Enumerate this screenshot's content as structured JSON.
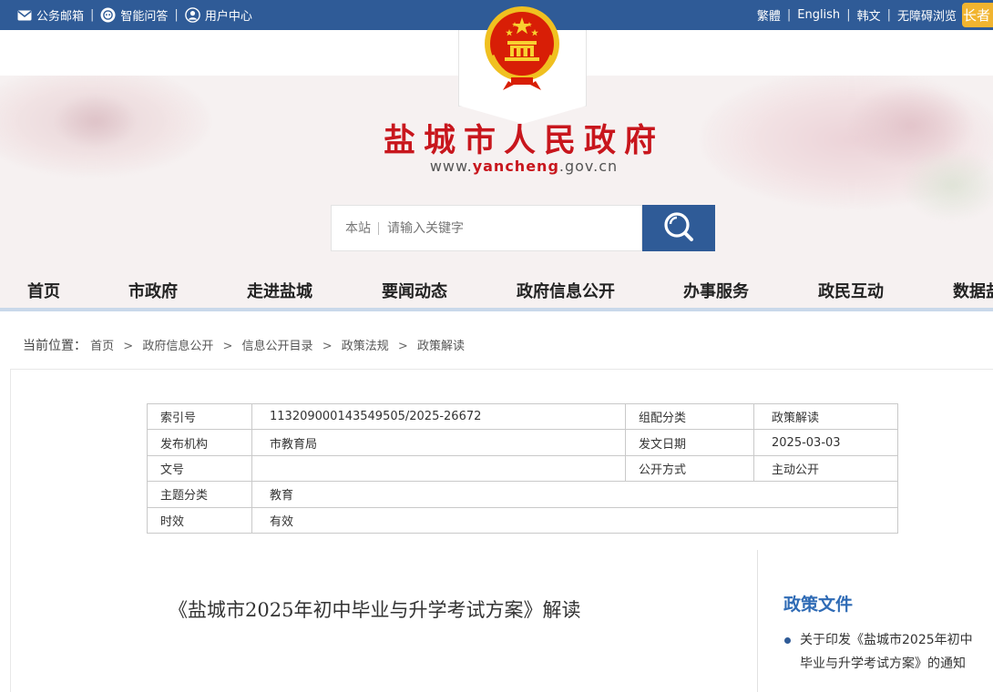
{
  "topbar": {
    "mail": "公务邮箱",
    "qa": "智能问答",
    "user": "用户中心",
    "lang_traditional": "繁體",
    "lang_english": "English",
    "lang_korean": "韩文",
    "accessibility": "无障碍浏览",
    "elder_mode": "长者"
  },
  "header": {
    "site_name": "盐城市人民政府",
    "url_prefix": "www.",
    "url_highlight": "yancheng",
    "url_suffix": ".gov.cn"
  },
  "search": {
    "scope": "本站",
    "placeholder": "请输入关键字"
  },
  "nav": {
    "items": [
      "首页",
      "市政府",
      "走进盐城",
      "要闻动态",
      "政府信息公开",
      "办事服务",
      "政民互动",
      "数据盐"
    ]
  },
  "breadcrumb": {
    "label": "当前位置：",
    "items": [
      "首页",
      "政府信息公开",
      "信息公开目录",
      "政策法规",
      "政策解读"
    ]
  },
  "meta": {
    "index_label": "索引号",
    "index_value": "113209000143549505/2025-26672",
    "category_label": "组配分类",
    "category_value": "政策解读",
    "publisher_label": "发布机构",
    "publisher_value": "市教育局",
    "date_label": "发文日期",
    "date_value": "2025-03-03",
    "docno_label": "文号",
    "docno_value": "",
    "open_label": "公开方式",
    "open_value": "主动公开",
    "topic_label": "主题分类",
    "topic_value": "教育",
    "validity_label": "时效",
    "validity_value": "有效"
  },
  "article": {
    "title": "《盐城市2025年初中毕业与升学考试方案》解读"
  },
  "sidebar": {
    "title": "政策文件",
    "items": [
      "关于印发《盐城市2025年初中毕业与升学考试方案》的通知"
    ]
  },
  "colors": {
    "topbar_bg": "#2f5b97",
    "title_red": "#c8161d",
    "link_blue": "#2f6bb5",
    "elder_button": "#f1b42f"
  }
}
